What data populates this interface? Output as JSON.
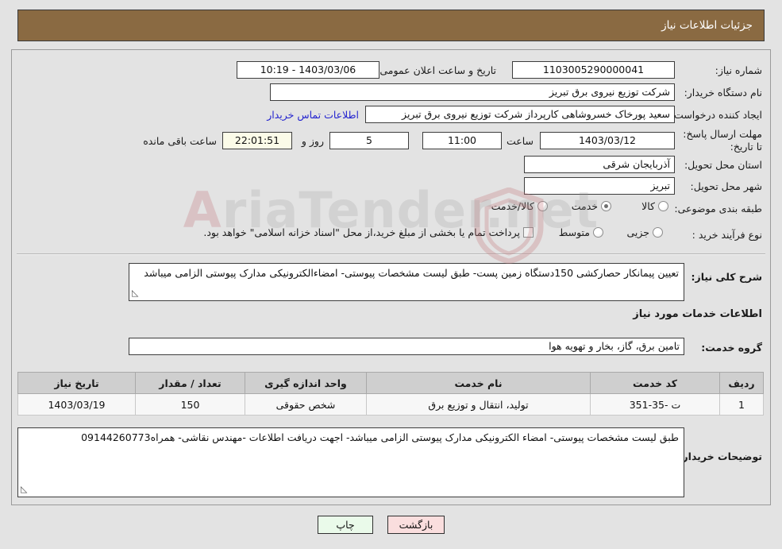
{
  "header": {
    "title": "جزئیات اطلاعات نیاز"
  },
  "watermark": {
    "text_left": "Ariа",
    "text_full": "AriaTender.net"
  },
  "form": {
    "need_number": {
      "label": "شماره نیاز:",
      "value": "1103005290000041"
    },
    "public_announce": {
      "label": "تاریخ و ساعت اعلان عمومی:",
      "value": "10:19 - 1403/03/06"
    },
    "buyer_org": {
      "label": "نام دستگاه خریدار:",
      "value": "شرکت توزیع نیروی برق تبریز"
    },
    "request_creator": {
      "label": "ایجاد کننده درخواست:",
      "value": "سعید پورخاک خسروشاهی کارپرداز شرکت توزیع نیروی برق تبریز"
    },
    "contact_link": {
      "label": "اطلاعات تماس خریدار"
    },
    "deadline": {
      "label": "مهلت ارسال پاسخ: تا تاریخ:",
      "date": "1403/03/12",
      "hour_label": "ساعت",
      "hour": "11:00",
      "days": "5",
      "days_label": "روز و",
      "countdown": "22:01:51",
      "remaining_label": "ساعت باقی مانده"
    },
    "province": {
      "label": "استان محل تحویل:",
      "value": "آذربایجان شرقی"
    },
    "city": {
      "label": "شهر محل تحویل:",
      "value": "تبریز"
    },
    "classification": {
      "label": "طبقه بندی موضوعی:",
      "options": [
        {
          "label": "کالا",
          "selected": false
        },
        {
          "label": "خدمت",
          "selected": true
        },
        {
          "label": "کالا/خدمت",
          "selected": false
        }
      ]
    },
    "purchase_process": {
      "label": "نوع فرآیند خرید :",
      "options": [
        {
          "label": "جزیی",
          "selected": false
        },
        {
          "label": "متوسط",
          "selected": false
        }
      ],
      "checkbox": {
        "label": "پرداخت تمام یا بخشی از مبلغ خرید،از محل \"اسناد خزانه اسلامی\" خواهد بود.",
        "checked": false
      }
    },
    "general_description": {
      "label": "شرح کلی نیاز:",
      "value": "تعیین پیمانکار حصارکشی 150دستگاه زمین پست- طبق لیست مشخصات پیوستی- امضاءالکترونیکی مدارک پیوستی الزامی میباشد"
    },
    "services_section_title": "اطلاعات خدمات مورد نیاز",
    "service_group": {
      "label": "گروه خدمت:",
      "value": "تامین برق، گاز، بخار و تهویه هوا"
    },
    "buyer_notes": {
      "label": "توضیحات خریدار:",
      "value": "طبق لیست مشخصات پیوستی- امضاء الکترونیکی مدارک پیوستی الزامی میباشد- اجهت دریافت اطلاعات -مهندس نقاشی- همراه09144260773"
    }
  },
  "table": {
    "columns": [
      "ردیف",
      "کد خدمت",
      "نام خدمت",
      "واحد اندازه گیری",
      "تعداد / مقدار",
      "تاریخ نیاز"
    ],
    "rows": [
      {
        "row": "1",
        "service_code": "ت -35-351",
        "service_name": "تولید، انتقال و توزیع برق",
        "unit": "شخص حقوقی",
        "quantity": "150",
        "need_date": "1403/03/19"
      }
    ]
  },
  "buttons": {
    "print": "چاپ",
    "back": "بازگشت"
  },
  "colors": {
    "header_bar": "#8a6a42",
    "link": "#2424cf",
    "print_button": "#eafaea",
    "back_button": "#fadede",
    "countdown_field": "#fbfbe8"
  }
}
